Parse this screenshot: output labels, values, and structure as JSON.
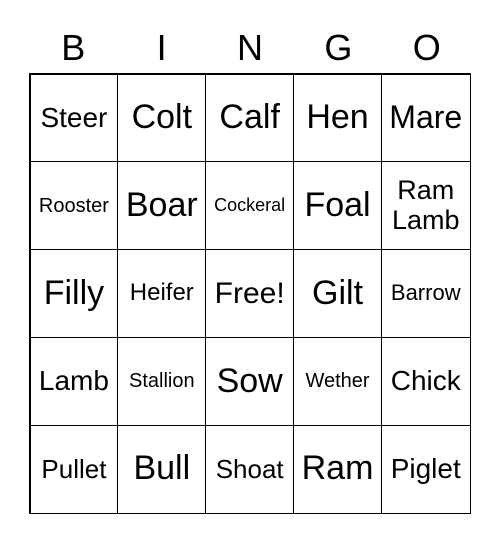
{
  "header": [
    "B",
    "I",
    "N",
    "G",
    "O"
  ],
  "cells": [
    {
      "text": "Steer",
      "size": 28
    },
    {
      "text": "Colt",
      "size": 34
    },
    {
      "text": "Calf",
      "size": 34
    },
    {
      "text": "Hen",
      "size": 34
    },
    {
      "text": "Mare",
      "size": 32
    },
    {
      "text": "Rooster",
      "size": 20
    },
    {
      "text": "Boar",
      "size": 34
    },
    {
      "text": "Cockeral",
      "size": 18
    },
    {
      "text": "Foal",
      "size": 34
    },
    {
      "text": "Ram Lamb",
      "size": 27
    },
    {
      "text": "Filly",
      "size": 34
    },
    {
      "text": "Heifer",
      "size": 24
    },
    {
      "text": "Free!",
      "size": 30
    },
    {
      "text": "Gilt",
      "size": 34
    },
    {
      "text": "Barrow",
      "size": 22
    },
    {
      "text": "Lamb",
      "size": 28
    },
    {
      "text": "Stallion",
      "size": 20
    },
    {
      "text": "Sow",
      "size": 34
    },
    {
      "text": "Wether",
      "size": 20
    },
    {
      "text": "Chick",
      "size": 28
    },
    {
      "text": "Pullet",
      "size": 26
    },
    {
      "text": "Bull",
      "size": 34
    },
    {
      "text": "Shoat",
      "size": 26
    },
    {
      "text": "Ram",
      "size": 34
    },
    {
      "text": "Piglet",
      "size": 28
    }
  ]
}
